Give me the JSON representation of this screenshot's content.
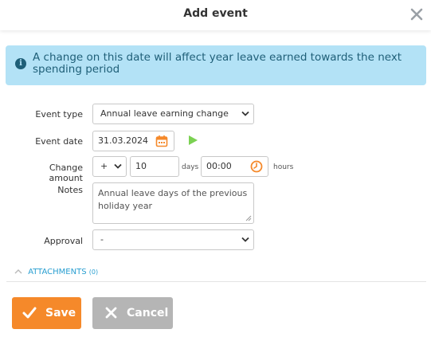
{
  "dialog": {
    "title": "Add event"
  },
  "banner": {
    "icon": "info-icon",
    "text": "A change on this date will affect year leave earned towards the next spending period"
  },
  "form": {
    "event_type": {
      "label": "Event type",
      "value": "Annual leave earning change"
    },
    "event_date": {
      "label": "Event date",
      "value": "31.03.2024"
    },
    "change_amount": {
      "label": "Change amount",
      "sign": "+",
      "days_value": "10",
      "days_unit": "days",
      "time_value": "00:00",
      "hours_unit": "hours"
    },
    "notes": {
      "label": "Notes",
      "value": "Annual leave days of the previous holiday year"
    },
    "approval": {
      "label": "Approval",
      "value": "-"
    }
  },
  "attachments": {
    "label": "ATTACHMENTS",
    "count": "(0)"
  },
  "buttons": {
    "save": "Save",
    "cancel": "Cancel"
  },
  "colors": {
    "accent": "#f5892a",
    "banner_bg": "#b3e2f6",
    "link": "#2a9fd1",
    "play": "#7bd152"
  }
}
